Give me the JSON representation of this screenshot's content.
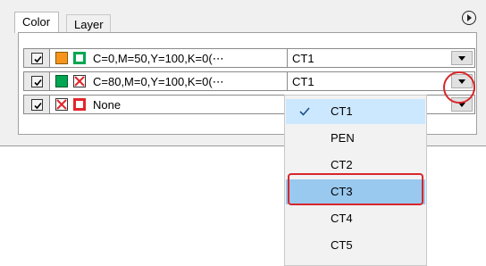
{
  "tabs": [
    {
      "label": "Color"
    },
    {
      "label": "Layer"
    }
  ],
  "rows": [
    {
      "checked": true,
      "fill_color": "#f7941d",
      "stroke_color": "#00a651",
      "fill_icon": "orange-fill-swatch-icon",
      "stroke_icon": "green-stroke-swatch-icon",
      "name": "C=0,M=50,Y=100,K=0(⋯",
      "ct": "CT1"
    },
    {
      "checked": true,
      "fill_color": "#00a651",
      "stroke_color": "#e0262b",
      "fill_icon": "green-fill-swatch-icon",
      "stroke_icon": "none-stroke-icon",
      "name": "C=80,M=0,Y=100,K=0(⋯",
      "ct": "CT1"
    },
    {
      "checked": true,
      "fill_color": "#e0262b",
      "stroke_color": "#e0262b",
      "fill_icon": "none-fill-icon",
      "stroke_icon": "red-stroke-swatch-icon",
      "name": "None",
      "ct": ""
    }
  ],
  "dropdown": {
    "items": [
      "CT1",
      "PEN",
      "CT2",
      "CT3",
      "CT4",
      "CT5"
    ],
    "checked_item": "CT1",
    "hovered_item": "CT3"
  },
  "annotation_color": "#d9262b"
}
